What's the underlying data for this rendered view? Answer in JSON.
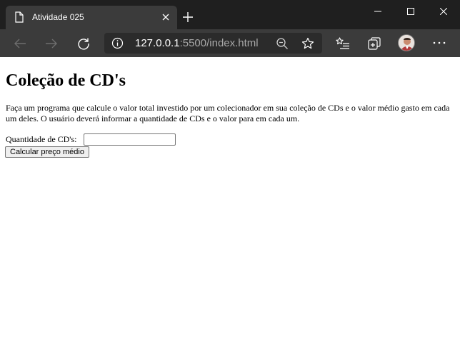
{
  "browser": {
    "tab_title": "Atividade 025",
    "url_host": "127.0.0.1",
    "url_rest": ":5500/index.html",
    "icons": {
      "tab": "document-icon",
      "close_tab": "close-icon",
      "new_tab": "plus-icon",
      "minimize": "minimize-icon",
      "maximize": "maximize-icon",
      "close_window": "close-icon",
      "back": "back-arrow-icon",
      "forward": "forward-arrow-icon",
      "reload": "reload-icon",
      "site_info": "info-icon",
      "zoom": "zoom-out-icon",
      "favorite": "star-icon",
      "favorites": "favorites-list-icon",
      "collections": "collections-icon",
      "profile": "avatar",
      "menu": "more-icon"
    },
    "colors": {
      "titlebar": "#1f1f1f",
      "toolbar": "#3b3b3b",
      "addressbar": "#2b2b2b"
    }
  },
  "page": {
    "title": "Coleção de CD's",
    "description": "Faça um programa que calcule o valor total investido por um colecionador em sua coleção de CDs e o valor médio gasto em cada um deles. O usuário deverá informar a quantidade de CDs e o valor para em cada um.",
    "quantity_label": "Quantidade de CD's:",
    "quantity_value": "",
    "button_label": "Calcular preço médio"
  }
}
